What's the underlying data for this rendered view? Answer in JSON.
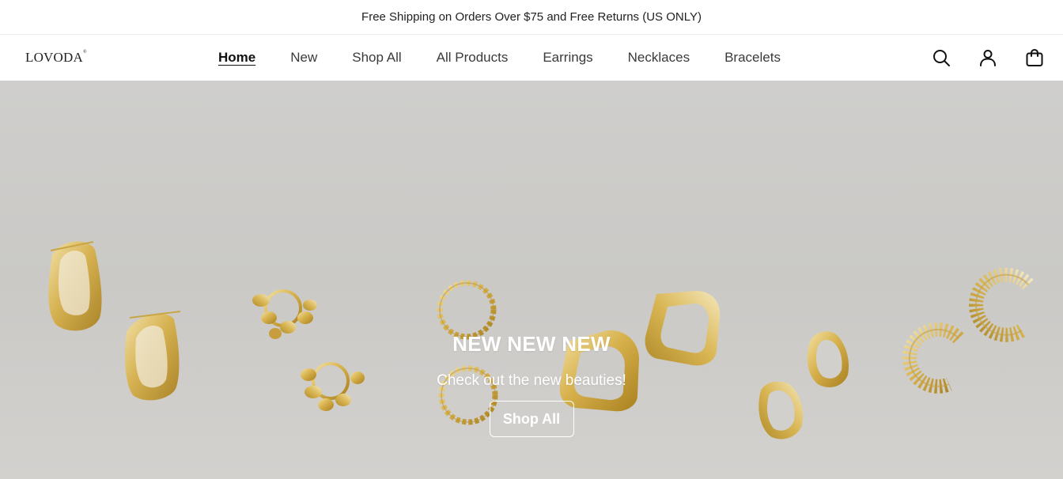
{
  "announcement": {
    "text": "Free Shipping on Orders Over $75 and Free Returns (US ONLY)"
  },
  "header": {
    "logo": "LOVODA",
    "nav": [
      {
        "label": "Home",
        "active": true
      },
      {
        "label": "New"
      },
      {
        "label": "Shop All"
      },
      {
        "label": "All Products"
      },
      {
        "label": "Earrings"
      },
      {
        "label": "Necklaces"
      },
      {
        "label": "Bracelets"
      }
    ],
    "icons": [
      "search-icon",
      "account-icon",
      "cart-icon"
    ]
  },
  "hero": {
    "heading": "NEW NEW NEW",
    "subheading": "Check out the new beauties!",
    "button_label": "Shop All"
  },
  "colors": {
    "gold": "#d6b04a",
    "gold_dark": "#b48a2a",
    "gold_light": "#f0dca0",
    "hero_bg": "#cccbc9"
  }
}
